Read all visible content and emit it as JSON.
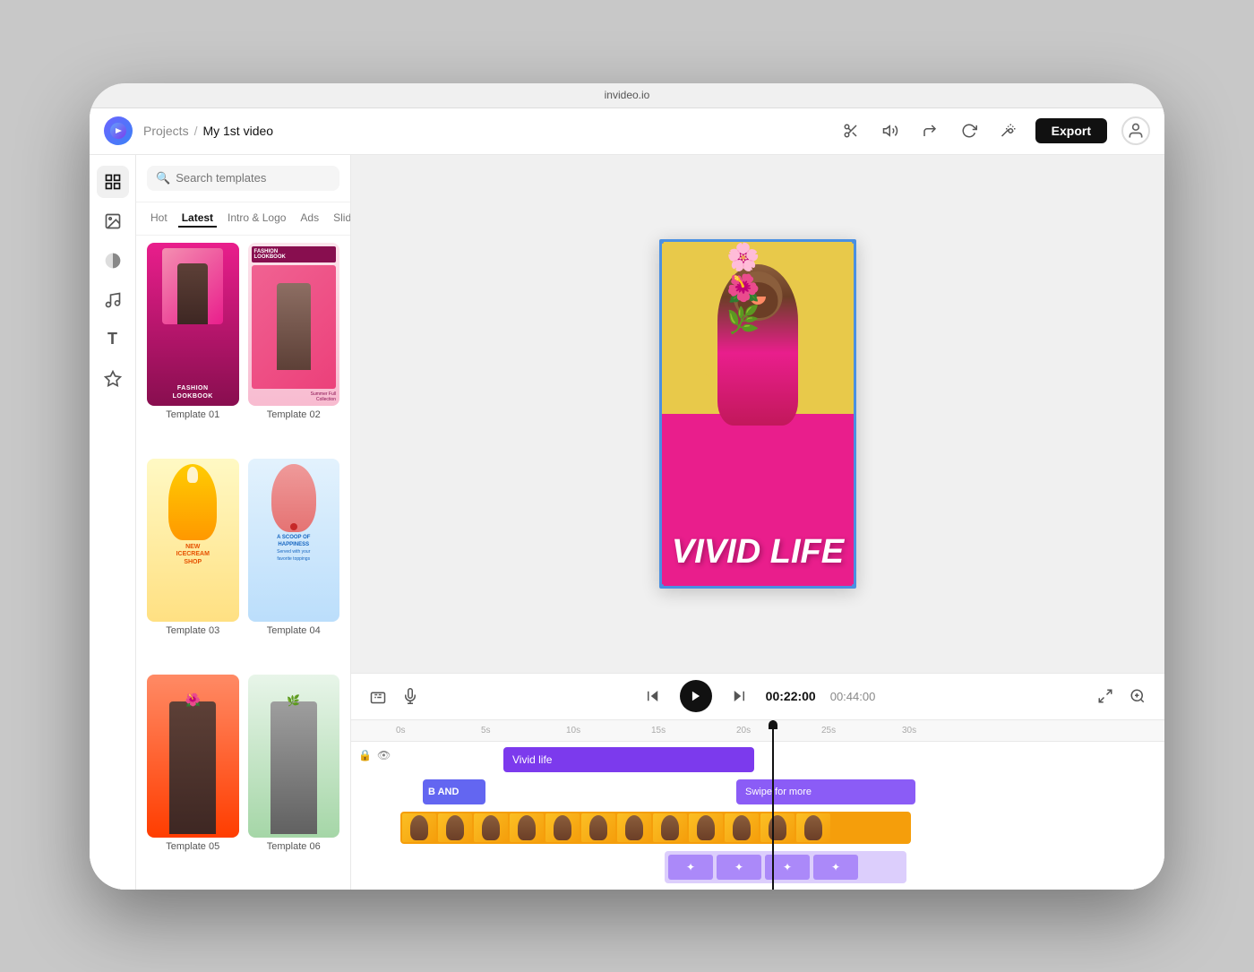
{
  "app": {
    "title": "invideo.io",
    "breadcrumb": {
      "projects": "Projects",
      "separator": "/",
      "current": "My 1st video"
    },
    "export_label": "Export"
  },
  "sidebar": {
    "icons": [
      {
        "name": "grid-icon",
        "symbol": "⊞"
      },
      {
        "name": "image-icon",
        "symbol": "🖼"
      },
      {
        "name": "filter-icon",
        "symbol": "◑"
      },
      {
        "name": "music-icon",
        "symbol": "♪"
      },
      {
        "name": "text-icon",
        "symbol": "T"
      },
      {
        "name": "star-icon",
        "symbol": "☆"
      }
    ]
  },
  "templates_panel": {
    "search_placeholder": "Search templates",
    "filter_tabs": [
      {
        "label": "Hot",
        "active": false
      },
      {
        "label": "Latest",
        "active": true
      },
      {
        "label": "Intro & Logo",
        "active": false
      },
      {
        "label": "Ads",
        "active": false
      },
      {
        "label": "Slides",
        "active": false
      }
    ],
    "templates": [
      {
        "label": "Template 01"
      },
      {
        "label": "Template 02"
      },
      {
        "label": "Template 03"
      },
      {
        "label": "Template 04"
      },
      {
        "label": "Template 05"
      },
      {
        "label": "Template 06"
      }
    ]
  },
  "canvas": {
    "video_title": "VIVID LIFE",
    "video_subtitle": ""
  },
  "playback": {
    "current_time": "00:22:00",
    "total_time": "00:44:00"
  },
  "timeline": {
    "ruler_marks": [
      "0s",
      "5s",
      "10s",
      "15s",
      "20s",
      "25s",
      "30s"
    ],
    "tracks": [
      {
        "name": "vivid-life-clip",
        "label": "Vivid life"
      },
      {
        "name": "brand-clip",
        "label": "B AND"
      },
      {
        "name": "swipe-clip",
        "label": "Swipe for more"
      }
    ]
  }
}
